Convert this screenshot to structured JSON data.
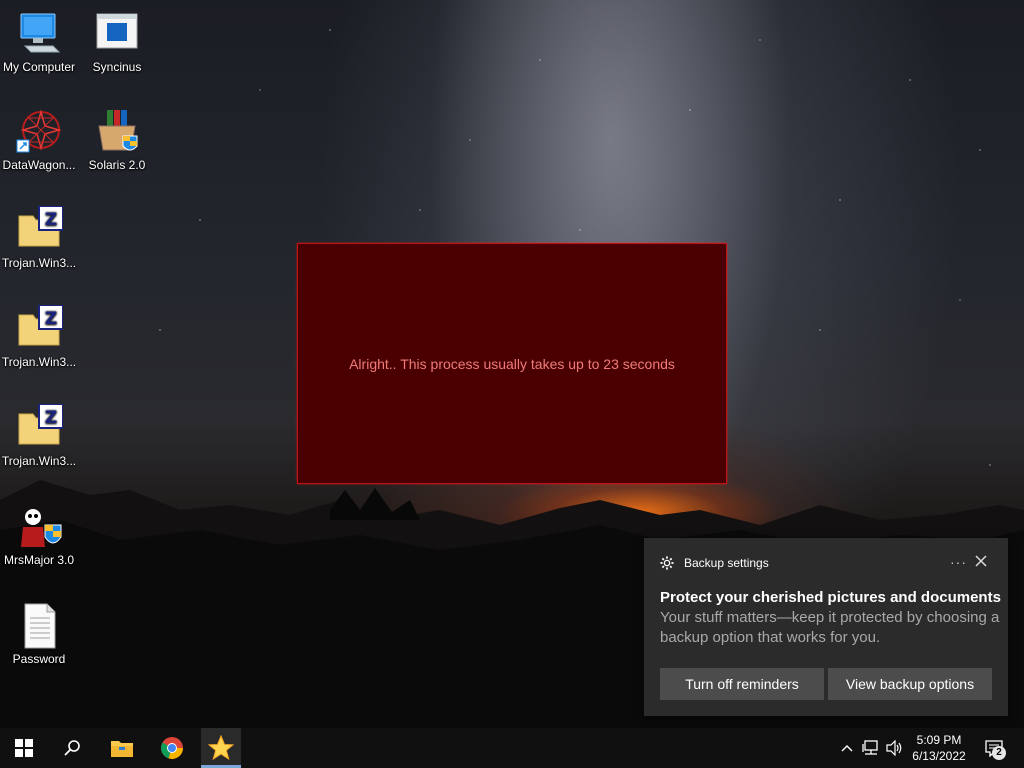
{
  "desktop": {
    "icons": [
      {
        "label": "My Computer",
        "icon": "computer-icon"
      },
      {
        "label": "Syncinus",
        "icon": "window-app-icon"
      },
      {
        "label": "DataWagon...",
        "icon": "star-shortcut-icon"
      },
      {
        "label": "Solaris 2.0",
        "icon": "installer-box-icon"
      },
      {
        "label": "Trojan.Win3...",
        "icon": "zip-folder-icon"
      },
      {
        "label": "Trojan.Win3...",
        "icon": "zip-folder-icon"
      },
      {
        "label": "Trojan.Win3...",
        "icon": "zip-folder-icon"
      },
      {
        "label": "MrsMajor 3.0",
        "icon": "skull-shield-icon"
      },
      {
        "label": "Password",
        "icon": "text-file-icon"
      }
    ]
  },
  "red_window": {
    "message": "Alright.. This process usually takes up to 23 seconds",
    "colors": {
      "background": "#4a0000",
      "border": "#c01010",
      "text": "#f07a7a"
    }
  },
  "toast": {
    "app_name": "Backup settings",
    "more_label": "···",
    "title": "Protect your cherished pictures and documents",
    "body": "Your stuff matters—keep it protected by choosing a backup option that works for you.",
    "buttons": {
      "turn_off": "Turn off reminders",
      "view_options": "View backup options"
    }
  },
  "taskbar": {
    "pinned": [
      "start-icon",
      "search-icon",
      "file-explorer-icon",
      "chrome-icon",
      "star-app-icon"
    ],
    "clock": {
      "time": "5:09 PM",
      "date": "6/13/2022"
    },
    "notification_count": "2"
  }
}
